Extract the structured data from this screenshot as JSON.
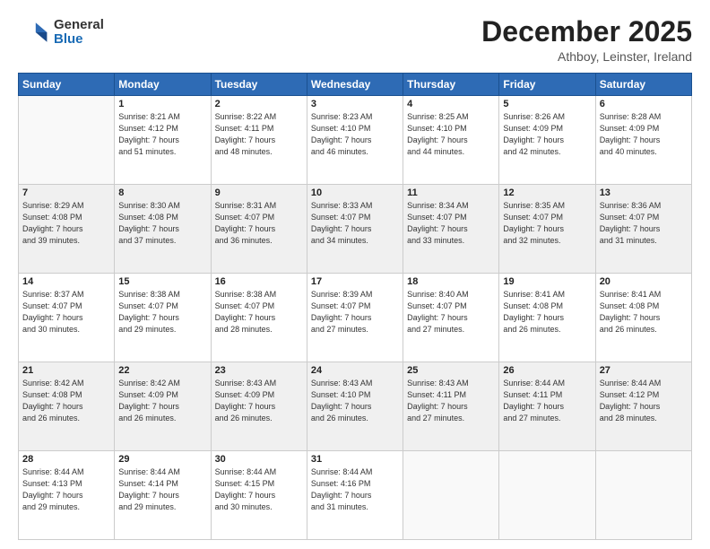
{
  "logo": {
    "general": "General",
    "blue": "Blue"
  },
  "header": {
    "month": "December 2025",
    "location": "Athboy, Leinster, Ireland"
  },
  "weekdays": [
    "Sunday",
    "Monday",
    "Tuesday",
    "Wednesday",
    "Thursday",
    "Friday",
    "Saturday"
  ],
  "weeks": [
    [
      {
        "day": "",
        "info": ""
      },
      {
        "day": "1",
        "info": "Sunrise: 8:21 AM\nSunset: 4:12 PM\nDaylight: 7 hours\nand 51 minutes."
      },
      {
        "day": "2",
        "info": "Sunrise: 8:22 AM\nSunset: 4:11 PM\nDaylight: 7 hours\nand 48 minutes."
      },
      {
        "day": "3",
        "info": "Sunrise: 8:23 AM\nSunset: 4:10 PM\nDaylight: 7 hours\nand 46 minutes."
      },
      {
        "day": "4",
        "info": "Sunrise: 8:25 AM\nSunset: 4:10 PM\nDaylight: 7 hours\nand 44 minutes."
      },
      {
        "day": "5",
        "info": "Sunrise: 8:26 AM\nSunset: 4:09 PM\nDaylight: 7 hours\nand 42 minutes."
      },
      {
        "day": "6",
        "info": "Sunrise: 8:28 AM\nSunset: 4:09 PM\nDaylight: 7 hours\nand 40 minutes."
      }
    ],
    [
      {
        "day": "7",
        "info": "Sunrise: 8:29 AM\nSunset: 4:08 PM\nDaylight: 7 hours\nand 39 minutes."
      },
      {
        "day": "8",
        "info": "Sunrise: 8:30 AM\nSunset: 4:08 PM\nDaylight: 7 hours\nand 37 minutes."
      },
      {
        "day": "9",
        "info": "Sunrise: 8:31 AM\nSunset: 4:07 PM\nDaylight: 7 hours\nand 36 minutes."
      },
      {
        "day": "10",
        "info": "Sunrise: 8:33 AM\nSunset: 4:07 PM\nDaylight: 7 hours\nand 34 minutes."
      },
      {
        "day": "11",
        "info": "Sunrise: 8:34 AM\nSunset: 4:07 PM\nDaylight: 7 hours\nand 33 minutes."
      },
      {
        "day": "12",
        "info": "Sunrise: 8:35 AM\nSunset: 4:07 PM\nDaylight: 7 hours\nand 32 minutes."
      },
      {
        "day": "13",
        "info": "Sunrise: 8:36 AM\nSunset: 4:07 PM\nDaylight: 7 hours\nand 31 minutes."
      }
    ],
    [
      {
        "day": "14",
        "info": "Sunrise: 8:37 AM\nSunset: 4:07 PM\nDaylight: 7 hours\nand 30 minutes."
      },
      {
        "day": "15",
        "info": "Sunrise: 8:38 AM\nSunset: 4:07 PM\nDaylight: 7 hours\nand 29 minutes."
      },
      {
        "day": "16",
        "info": "Sunrise: 8:38 AM\nSunset: 4:07 PM\nDaylight: 7 hours\nand 28 minutes."
      },
      {
        "day": "17",
        "info": "Sunrise: 8:39 AM\nSunset: 4:07 PM\nDaylight: 7 hours\nand 27 minutes."
      },
      {
        "day": "18",
        "info": "Sunrise: 8:40 AM\nSunset: 4:07 PM\nDaylight: 7 hours\nand 27 minutes."
      },
      {
        "day": "19",
        "info": "Sunrise: 8:41 AM\nSunset: 4:08 PM\nDaylight: 7 hours\nand 26 minutes."
      },
      {
        "day": "20",
        "info": "Sunrise: 8:41 AM\nSunset: 4:08 PM\nDaylight: 7 hours\nand 26 minutes."
      }
    ],
    [
      {
        "day": "21",
        "info": "Sunrise: 8:42 AM\nSunset: 4:08 PM\nDaylight: 7 hours\nand 26 minutes."
      },
      {
        "day": "22",
        "info": "Sunrise: 8:42 AM\nSunset: 4:09 PM\nDaylight: 7 hours\nand 26 minutes."
      },
      {
        "day": "23",
        "info": "Sunrise: 8:43 AM\nSunset: 4:09 PM\nDaylight: 7 hours\nand 26 minutes."
      },
      {
        "day": "24",
        "info": "Sunrise: 8:43 AM\nSunset: 4:10 PM\nDaylight: 7 hours\nand 26 minutes."
      },
      {
        "day": "25",
        "info": "Sunrise: 8:43 AM\nSunset: 4:11 PM\nDaylight: 7 hours\nand 27 minutes."
      },
      {
        "day": "26",
        "info": "Sunrise: 8:44 AM\nSunset: 4:11 PM\nDaylight: 7 hours\nand 27 minutes."
      },
      {
        "day": "27",
        "info": "Sunrise: 8:44 AM\nSunset: 4:12 PM\nDaylight: 7 hours\nand 28 minutes."
      }
    ],
    [
      {
        "day": "28",
        "info": "Sunrise: 8:44 AM\nSunset: 4:13 PM\nDaylight: 7 hours\nand 29 minutes."
      },
      {
        "day": "29",
        "info": "Sunrise: 8:44 AM\nSunset: 4:14 PM\nDaylight: 7 hours\nand 29 minutes."
      },
      {
        "day": "30",
        "info": "Sunrise: 8:44 AM\nSunset: 4:15 PM\nDaylight: 7 hours\nand 30 minutes."
      },
      {
        "day": "31",
        "info": "Sunrise: 8:44 AM\nSunset: 4:16 PM\nDaylight: 7 hours\nand 31 minutes."
      },
      {
        "day": "",
        "info": ""
      },
      {
        "day": "",
        "info": ""
      },
      {
        "day": "",
        "info": ""
      }
    ]
  ]
}
